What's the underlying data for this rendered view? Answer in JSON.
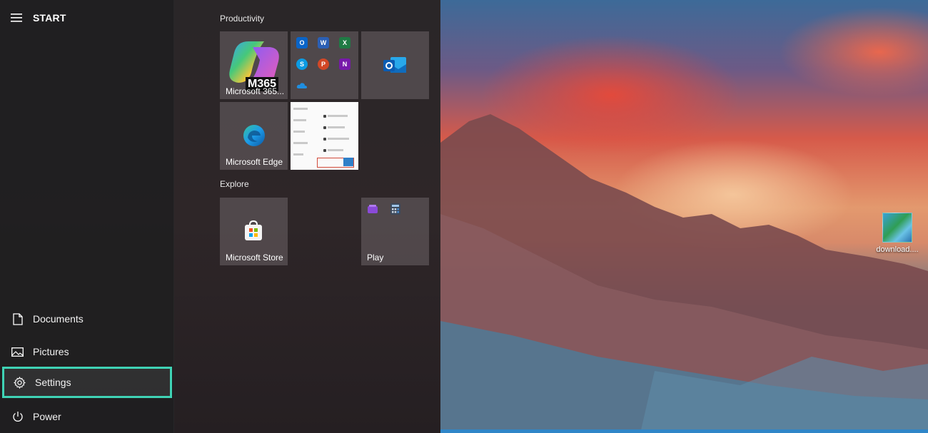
{
  "start": {
    "title": "START",
    "rail": {
      "documents": "Documents",
      "pictures": "Pictures",
      "settings": "Settings",
      "power": "Power"
    },
    "groups": {
      "productivity": "Productivity",
      "explore": "Explore"
    },
    "tiles": {
      "m365": "Microsoft 365...",
      "m365_badge": "M365",
      "edge": "Microsoft Edge",
      "store": "Microsoft Store",
      "play": "Play"
    },
    "office_apps": [
      "O",
      "W",
      "X",
      "S",
      "P",
      "N"
    ]
  },
  "desktop": {
    "icon_label": "download...."
  },
  "colors": {
    "highlight": "#3fd3b5",
    "outlook": "#0a64c8",
    "word": "#2b5fb4",
    "excel": "#1f7a44",
    "skype": "#0b9be3",
    "powerpoint": "#d24726",
    "onenote": "#7719aa"
  }
}
